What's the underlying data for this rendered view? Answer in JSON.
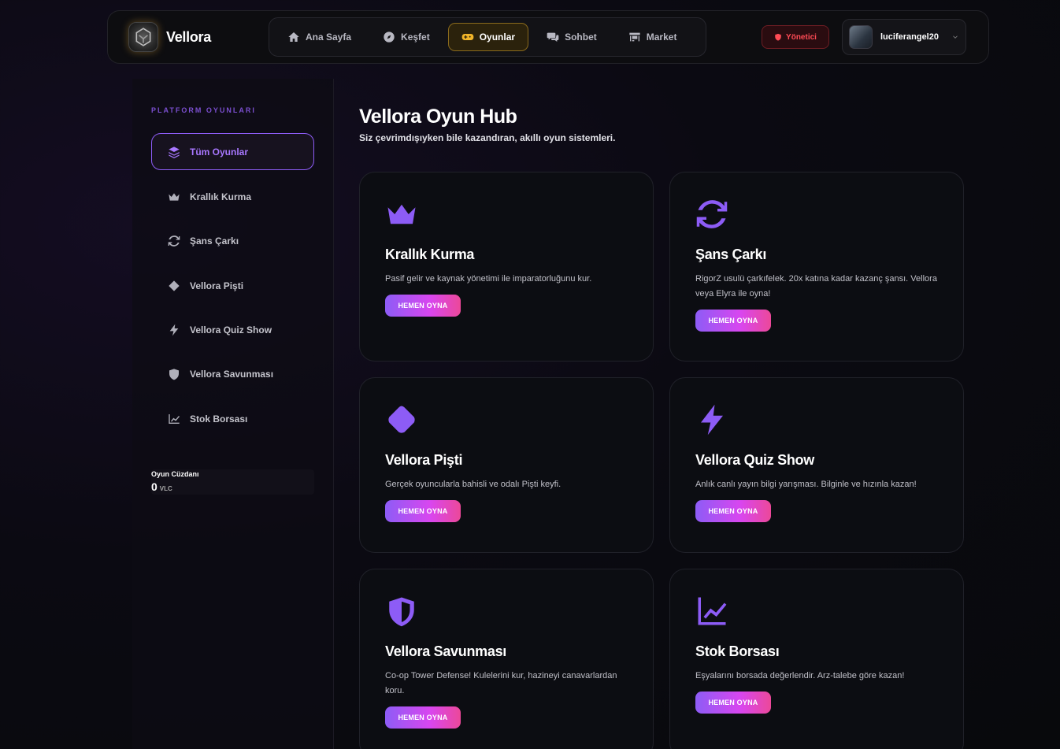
{
  "brand": {
    "name": "Vellora"
  },
  "nav": [
    {
      "label": "Ana Sayfa",
      "icon": "home-icon"
    },
    {
      "label": "Keşfet",
      "icon": "compass-icon"
    },
    {
      "label": "Oyunlar",
      "icon": "gamepad-icon",
      "active": true
    },
    {
      "label": "Sohbet",
      "icon": "chat-icon"
    },
    {
      "label": "Market",
      "icon": "store-icon"
    }
  ],
  "admin_label": "Yönetici",
  "user": {
    "name": "luciferangel20"
  },
  "sidebar": {
    "title": "PLATFORM OYUNLARI",
    "items": [
      {
        "label": "Tüm Oyunlar",
        "icon": "layers-icon",
        "active": true
      },
      {
        "label": "Krallık Kurma",
        "icon": "crown-icon"
      },
      {
        "label": "Şans Çarkı",
        "icon": "refresh-icon"
      },
      {
        "label": "Vellora Pişti",
        "icon": "diamond-icon"
      },
      {
        "label": "Vellora Quiz Show",
        "icon": "bolt-icon"
      },
      {
        "label": "Vellora Savunması",
        "icon": "shield-icon"
      },
      {
        "label": "Stok Borsası",
        "icon": "chart-line-icon"
      }
    ],
    "wallet": {
      "label": "Oyun Cüzdanı",
      "amount": "0",
      "unit": "VLC"
    }
  },
  "main": {
    "title": "Vellora Oyun Hub",
    "subtitle": "Siz çevrimdışıyken bile kazandıran, akıllı oyun sistemleri.",
    "play_label": "HEMEN OYNA",
    "cards": [
      {
        "title": "Krallık Kurma",
        "desc": "Pasif gelir ve kaynak yönetimi ile imparatorluğunu kur.",
        "icon": "crown-icon"
      },
      {
        "title": "Şans Çarkı",
        "desc": "RigorZ usulü çarkıfelek. 20x katına kadar kazanç şansı. Vellora veya Elyra ile oyna!",
        "icon": "refresh-icon"
      },
      {
        "title": "Vellora Pişti",
        "desc": "Gerçek oyuncularla bahisli ve odalı Pişti keyfi.",
        "icon": "diamond-icon"
      },
      {
        "title": "Vellora Quiz Show",
        "desc": "Anlık canlı yayın bilgi yarışması. Bilginle ve hızınla kazan!",
        "icon": "bolt-icon"
      },
      {
        "title": "Vellora Savunması",
        "desc": "Co-op Tower Defense! Kulelerini kur, hazineyi canavarlardan koru.",
        "icon": "shield-icon"
      },
      {
        "title": "Stok Borsası",
        "desc": "Eşyalarını borsada değerlendir. Arz-talebe göre kazan!",
        "icon": "chart-line-icon"
      }
    ]
  },
  "colors": {
    "accent": "#8d5cf6",
    "gold": "#f0b429",
    "danger": "#ff4b55"
  }
}
